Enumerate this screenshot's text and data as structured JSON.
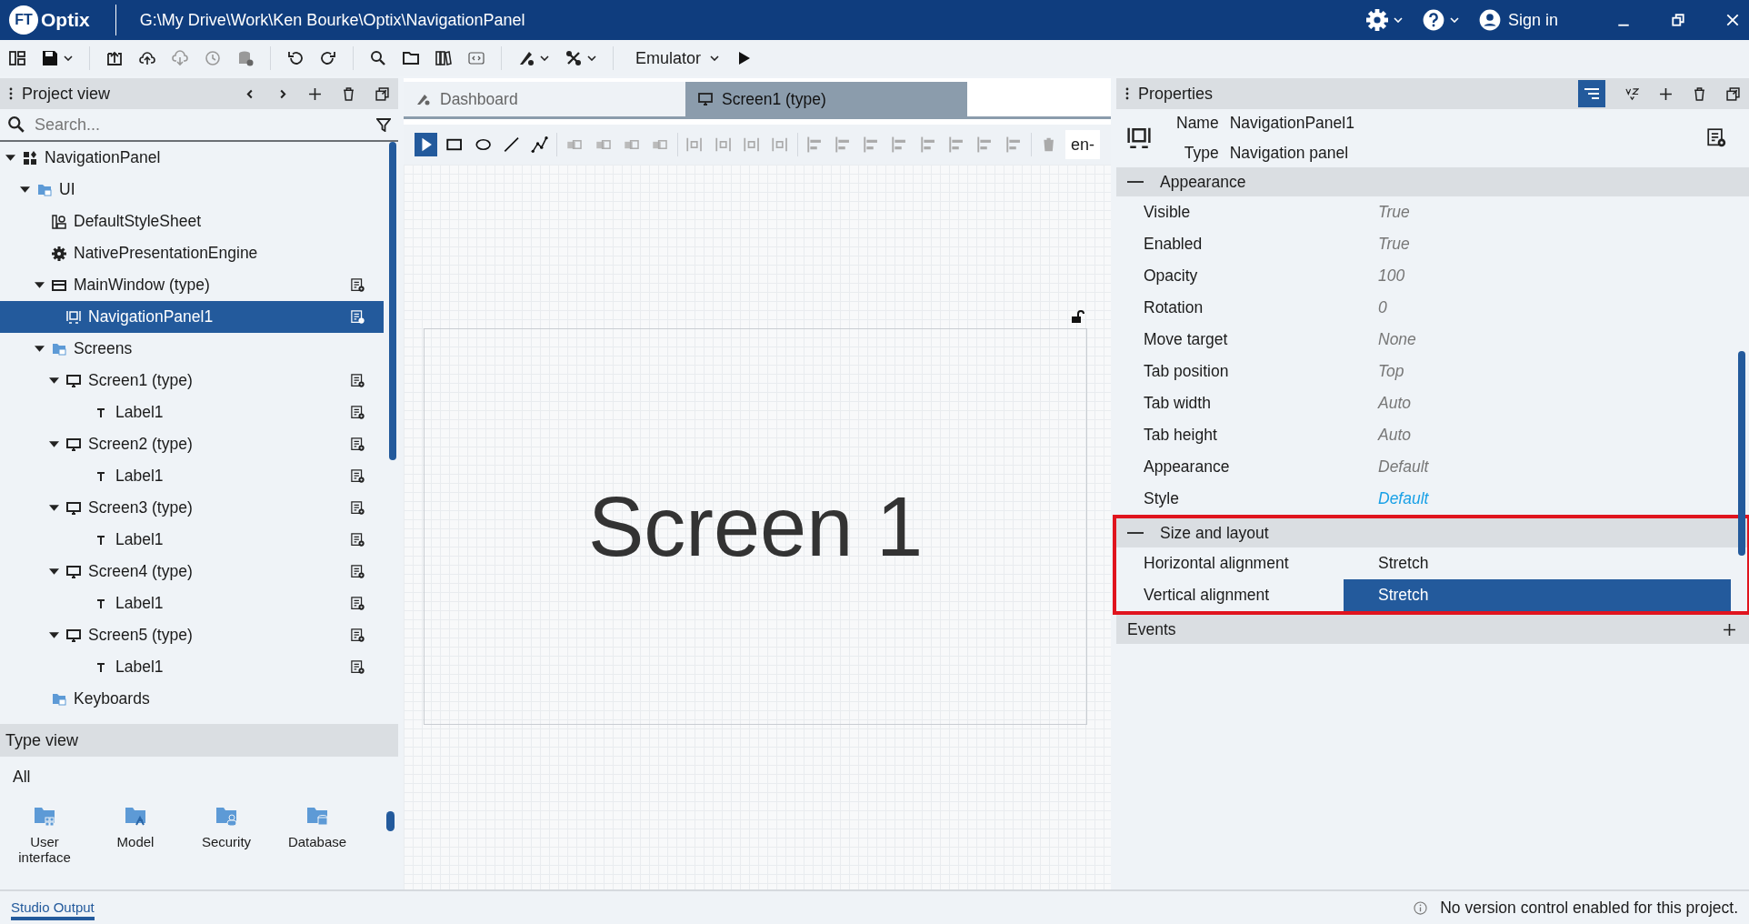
{
  "title_bar": {
    "logo_mark": "FT",
    "app_name": "Optix",
    "path": "G:\\My Drive\\Work\\Ken Bourke\\Optix\\NavigationPanel",
    "sign_in": "Sign in"
  },
  "toolbar": {
    "emulator": "Emulator"
  },
  "project_view": {
    "title": "Project view",
    "search_placeholder": "Search...",
    "tree": [
      {
        "label": "NavigationPanel",
        "kind": "project",
        "expanded": true,
        "selected": false,
        "settings": false,
        "children": [
          {
            "label": "UI",
            "kind": "folder-ui",
            "expanded": true,
            "selected": false,
            "settings": false,
            "children": [
              {
                "label": "DefaultStyleSheet",
                "kind": "stylesheet",
                "selected": false,
                "settings": false
              },
              {
                "label": "NativePresentationEngine",
                "kind": "engine",
                "selected": false,
                "settings": false
              },
              {
                "label": "MainWindow (type)",
                "kind": "window",
                "expanded": true,
                "selected": false,
                "settings": true,
                "children": [
                  {
                    "label": "NavigationPanel1",
                    "kind": "navpanel",
                    "selected": true,
                    "settings": true
                  }
                ]
              },
              {
                "label": "Screens",
                "kind": "folder-screens",
                "expanded": true,
                "selected": false,
                "settings": false,
                "children": [
                  {
                    "label": "Screen1 (type)",
                    "kind": "screen",
                    "expanded": true,
                    "selected": false,
                    "settings": true,
                    "children": [
                      {
                        "label": "Label1",
                        "kind": "label",
                        "selected": false,
                        "settings": true
                      }
                    ]
                  },
                  {
                    "label": "Screen2 (type)",
                    "kind": "screen",
                    "expanded": true,
                    "selected": false,
                    "settings": true,
                    "children": [
                      {
                        "label": "Label1",
                        "kind": "label",
                        "selected": false,
                        "settings": true
                      }
                    ]
                  },
                  {
                    "label": "Screen3 (type)",
                    "kind": "screen",
                    "expanded": true,
                    "selected": false,
                    "settings": true,
                    "children": [
                      {
                        "label": "Label1",
                        "kind": "label",
                        "selected": false,
                        "settings": true
                      }
                    ]
                  },
                  {
                    "label": "Screen4 (type)",
                    "kind": "screen",
                    "expanded": true,
                    "selected": false,
                    "settings": true,
                    "children": [
                      {
                        "label": "Label1",
                        "kind": "label",
                        "selected": false,
                        "settings": true
                      }
                    ]
                  },
                  {
                    "label": "Screen5 (type)",
                    "kind": "screen",
                    "expanded": true,
                    "selected": false,
                    "settings": true,
                    "children": [
                      {
                        "label": "Label1",
                        "kind": "label",
                        "selected": false,
                        "settings": true
                      }
                    ]
                  }
                ]
              },
              {
                "label": "Keyboards",
                "kind": "folder-keyboard",
                "selected": false,
                "settings": false
              }
            ]
          }
        ]
      }
    ]
  },
  "type_view": {
    "title": "Type view",
    "filter": "All",
    "items": [
      {
        "label": "User interface",
        "kind": "ui"
      },
      {
        "label": "Model",
        "kind": "model"
      },
      {
        "label": "Security",
        "kind": "security"
      },
      {
        "label": "Database",
        "kind": "database"
      }
    ]
  },
  "editor": {
    "tabs": [
      {
        "label": "Dashboard",
        "kind": "dashboard",
        "selected": false
      },
      {
        "label": "Screen1 (type)",
        "kind": "screen",
        "selected": true
      }
    ],
    "tools": [
      {
        "kind": "pointer",
        "selected": true
      },
      {
        "kind": "rectangle",
        "selected": false
      },
      {
        "kind": "ellipse",
        "selected": false
      },
      {
        "kind": "line",
        "selected": false
      },
      {
        "kind": "polyline",
        "selected": false
      }
    ],
    "language": "en-",
    "canvas_text": "Screen 1"
  },
  "properties": {
    "title": "Properties",
    "name_label": "Name",
    "name": "NavigationPanel1",
    "type_label": "Type",
    "type": "Navigation panel",
    "sections": [
      {
        "title": "Appearance",
        "expanded": true,
        "highlighted": false,
        "rows": [
          {
            "label": "Visible",
            "value": "True",
            "kind": "default",
            "selected": false
          },
          {
            "label": "Enabled",
            "value": "True",
            "kind": "default",
            "selected": false
          },
          {
            "label": "Opacity",
            "value": "100",
            "kind": "default",
            "selected": false
          },
          {
            "label": "Rotation",
            "value": "0",
            "kind": "default",
            "selected": false
          },
          {
            "label": "Move target",
            "value": "None",
            "kind": "default",
            "selected": false
          },
          {
            "label": "Tab position",
            "value": "Top",
            "kind": "default",
            "selected": false
          },
          {
            "label": "Tab width",
            "value": "Auto",
            "kind": "default",
            "selected": false
          },
          {
            "label": "Tab height",
            "value": "Auto",
            "kind": "default",
            "selected": false
          },
          {
            "label": "Appearance",
            "value": "Default",
            "kind": "default",
            "selected": false
          },
          {
            "label": "Style",
            "value": "Default",
            "kind": "link",
            "selected": false
          }
        ]
      },
      {
        "title": "Size and layout",
        "expanded": true,
        "highlighted": true,
        "rows": [
          {
            "label": "Horizontal alignment",
            "value": "Stretch",
            "kind": "set",
            "selected": false
          },
          {
            "label": "Vertical alignment",
            "value": "Stretch",
            "kind": "set",
            "selected": true
          }
        ]
      }
    ],
    "events": "Events"
  },
  "status_bar": {
    "output_tab": "Studio Output",
    "message": "No version control enabled for this project."
  }
}
